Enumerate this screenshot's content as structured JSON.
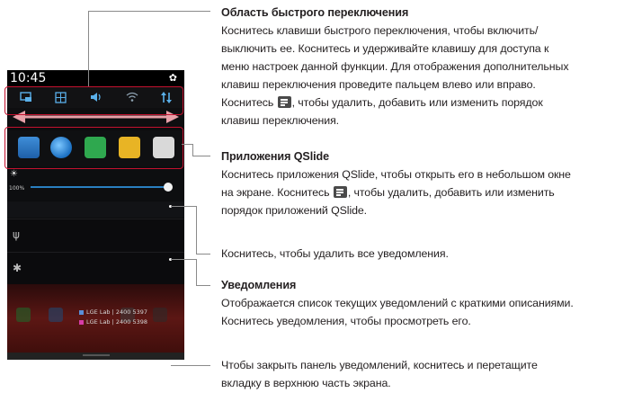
{
  "phone": {
    "time": "10:45",
    "brightness_label": "100%",
    "notifications": [
      {
        "title": "LGE Lab",
        "number": "2400 5397"
      },
      {
        "title": "LGE Lab",
        "number": "2400 5398"
      }
    ]
  },
  "sections": {
    "quick_settings": {
      "title": "Область быстрого переключения",
      "line1": "Коснитесь клавиши быстрого переключения, чтобы включить/",
      "line2": "выключить ее. Коснитесь и удерживайте клавишу для доступа к",
      "line3": "меню настроек данной функции. Для отображения дополнительных",
      "line4": "клавиш переключения проведите пальцем влево или вправо.",
      "line5_before": "Коснитесь",
      "line5_after": "чтобы удалить, добавить или изменить порядок",
      "line6": "клавиш переключения."
    },
    "qslide": {
      "title": "Приложения QSlide",
      "line1": "Коснитесь приложения QSlide, чтобы открыть его в небольшом окне",
      "line2_before": "на экране. Коснитесь",
      "line2_after": "чтобы удалить, добавить или изменить",
      "line3": "порядок приложений QSlide."
    },
    "clear": {
      "line1": "Коснитесь, чтобы удалить все уведомления."
    },
    "notifications": {
      "title": "Уведомления",
      "line1": "Отображается список текущих уведомлений с краткими описаниями.",
      "line2": "Коснитесь уведомления, чтобы просмотреть его."
    },
    "close": {
      "line1": "Чтобы закрыть панель уведомлений, коснитесь и перетащите",
      "line2": "вкладку в верхнюю часть экрана."
    }
  },
  "colors": {
    "callout_red": "#c4122f",
    "arrow_pink": "#e8a0a8",
    "text": "#231f20"
  }
}
